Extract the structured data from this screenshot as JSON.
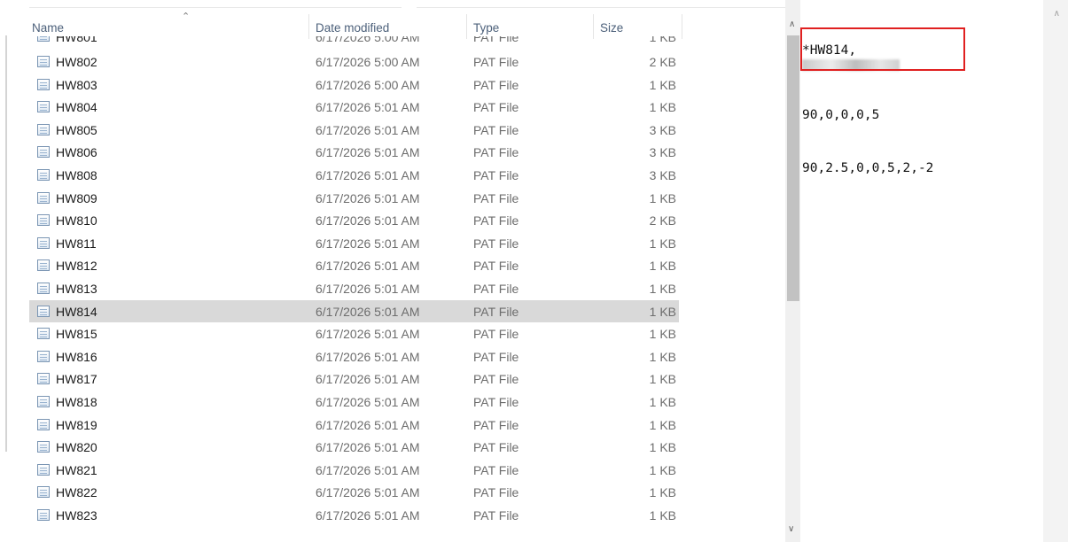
{
  "explorer": {
    "columns": {
      "name": "Name",
      "date": "Date modified",
      "type": "Type",
      "size": "Size"
    },
    "clipped_row": {
      "name": "HW801",
      "date": "6/17/2026 5:00 AM",
      "type": "PAT File",
      "size": "1 KB"
    },
    "rows": [
      {
        "name": "HW802",
        "date": "6/17/2026 5:00 AM",
        "type": "PAT File",
        "size": "2 KB"
      },
      {
        "name": "HW803",
        "date": "6/17/2026 5:00 AM",
        "type": "PAT File",
        "size": "1 KB"
      },
      {
        "name": "HW804",
        "date": "6/17/2026 5:01 AM",
        "type": "PAT File",
        "size": "1 KB"
      },
      {
        "name": "HW805",
        "date": "6/17/2026 5:01 AM",
        "type": "PAT File",
        "size": "3 KB"
      },
      {
        "name": "HW806",
        "date": "6/17/2026 5:01 AM",
        "type": "PAT File",
        "size": "3 KB"
      },
      {
        "name": "HW808",
        "date": "6/17/2026 5:01 AM",
        "type": "PAT File",
        "size": "3 KB"
      },
      {
        "name": "HW809",
        "date": "6/17/2026 5:01 AM",
        "type": "PAT File",
        "size": "1 KB"
      },
      {
        "name": "HW810",
        "date": "6/17/2026 5:01 AM",
        "type": "PAT File",
        "size": "2 KB"
      },
      {
        "name": "HW811",
        "date": "6/17/2026 5:01 AM",
        "type": "PAT File",
        "size": "1 KB"
      },
      {
        "name": "HW812",
        "date": "6/17/2026 5:01 AM",
        "type": "PAT File",
        "size": "1 KB"
      },
      {
        "name": "HW813",
        "date": "6/17/2026 5:01 AM",
        "type": "PAT File",
        "size": "1 KB"
      },
      {
        "name": "HW814",
        "date": "6/17/2026 5:01 AM",
        "type": "PAT File",
        "size": "1 KB",
        "selected": true
      },
      {
        "name": "HW815",
        "date": "6/17/2026 5:01 AM",
        "type": "PAT File",
        "size": "1 KB"
      },
      {
        "name": "HW816",
        "date": "6/17/2026 5:01 AM",
        "type": "PAT File",
        "size": "1 KB"
      },
      {
        "name": "HW817",
        "date": "6/17/2026 5:01 AM",
        "type": "PAT File",
        "size": "1 KB"
      },
      {
        "name": "HW818",
        "date": "6/17/2026 5:01 AM",
        "type": "PAT File",
        "size": "1 KB"
      },
      {
        "name": "HW819",
        "date": "6/17/2026 5:01 AM",
        "type": "PAT File",
        "size": "1 KB"
      },
      {
        "name": "HW820",
        "date": "6/17/2026 5:01 AM",
        "type": "PAT File",
        "size": "1 KB"
      },
      {
        "name": "HW821",
        "date": "6/17/2026 5:01 AM",
        "type": "PAT File",
        "size": "1 KB"
      },
      {
        "name": "HW822",
        "date": "6/17/2026 5:01 AM",
        "type": "PAT File",
        "size": "1 KB"
      },
      {
        "name": "HW823",
        "date": "6/17/2026 5:01 AM",
        "type": "PAT File",
        "size": "1 KB"
      }
    ],
    "selected_color": "#d9d9d9"
  },
  "notepad": {
    "line1_prefix": "*HW814,",
    "line2": "90,0,0,0,5",
    "line3": "90,2.5,0,0,5,2,-2",
    "highlight_color": "#e02020"
  },
  "icons": {
    "sort": "chevron-up-icon",
    "file": "pat-file-icon",
    "scroll_up": "scroll-up-arrow-icon",
    "scroll_down": "scroll-down-arrow-icon"
  }
}
